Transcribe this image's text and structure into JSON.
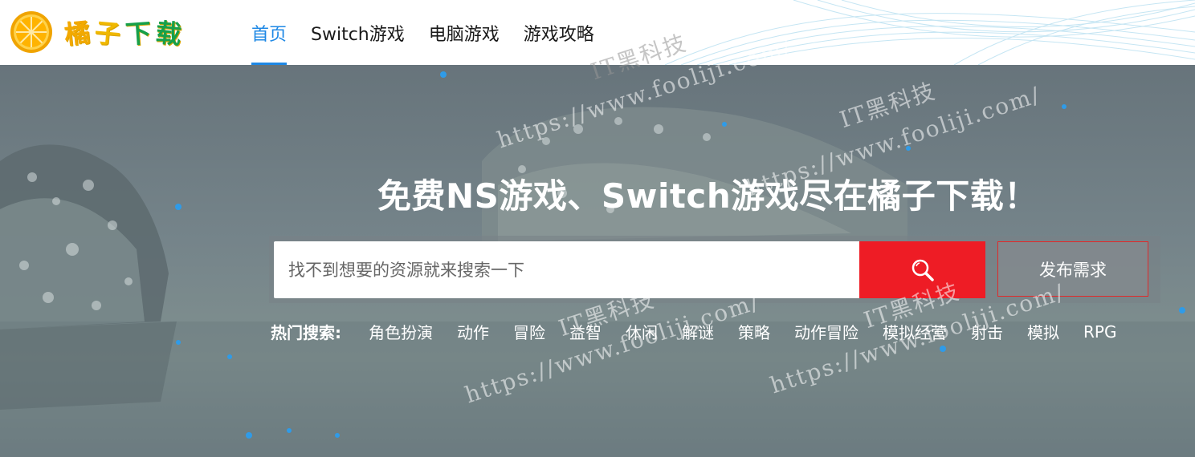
{
  "header": {
    "logo_text": [
      "橘",
      "子",
      "下",
      "载"
    ],
    "nav": [
      {
        "label": "首页",
        "active": true
      },
      {
        "label": "Switch游戏",
        "active": false
      },
      {
        "label": "电脑游戏",
        "active": false
      },
      {
        "label": "游戏攻略",
        "active": false
      }
    ]
  },
  "hero": {
    "title": "免费NS游戏、Switch游戏尽在橘子下载！",
    "search": {
      "placeholder": "找不到想要的资源就来搜索一下",
      "button_icon": "search-icon"
    },
    "publish_label": "发布需求",
    "hot": {
      "label": "热门搜索:",
      "items": [
        "角色扮演",
        "动作",
        "冒险",
        "益智",
        "休闲",
        "解谜",
        "策略",
        "动作冒险",
        "模拟经营",
        "射击",
        "模拟",
        "RPG"
      ]
    }
  },
  "watermark": {
    "brand": "IT黑科技",
    "url": "https://www.fooliji.com/"
  },
  "colors": {
    "nav_active": "#1e88e5",
    "search_button": "#ee1c25",
    "publish_border": "#e02a2a",
    "logo_orange": "#f3a900",
    "logo_green": "#17a04a"
  }
}
